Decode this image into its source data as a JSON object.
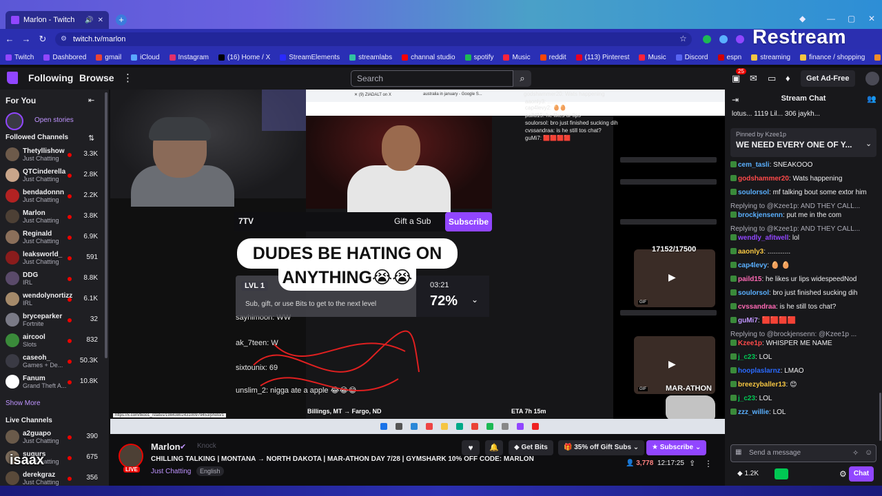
{
  "browser": {
    "tab_title": "Marlon - Twitch",
    "new_tab": "+",
    "url": "twitch.tv/marlon",
    "restream_logo": "Restream",
    "bookmarks": [
      {
        "label": "Twitch",
        "color": "#9146ff"
      },
      {
        "label": "Dashbored",
        "color": "#9146ff"
      },
      {
        "label": "gmail",
        "color": "#ea4335"
      },
      {
        "label": "iCloud",
        "color": "#5aa7ff"
      },
      {
        "label": "Instagram",
        "color": "#e1306c"
      },
      {
        "label": "(16) Home / X",
        "color": "#000000"
      },
      {
        "label": "StreamElements",
        "color": "#2a2aff"
      },
      {
        "label": "streamlabs",
        "color": "#31c3a2"
      },
      {
        "label": "channal studio",
        "color": "#ff0000"
      },
      {
        "label": "spotify",
        "color": "#1db954"
      },
      {
        "label": "Music",
        "color": "#fa233b"
      },
      {
        "label": "reddit",
        "color": "#ff4500"
      },
      {
        "label": "(113) Pinterest",
        "color": "#e60023"
      },
      {
        "label": "Music",
        "color": "#fa233b"
      },
      {
        "label": "Discord",
        "color": "#5865f2"
      },
      {
        "label": "espn",
        "color": "#d00000"
      },
      {
        "label": "streaming",
        "color": "#f5c542"
      },
      {
        "label": "finance / shopping",
        "color": "#f5c542"
      },
      {
        "label": "Cjdropshipping",
        "color": "#f28c28"
      }
    ]
  },
  "topnav": {
    "following": "Following",
    "browse": "Browse",
    "search_placeholder": "Search",
    "notif_count": "25",
    "ad_free": "Get Ad-Free"
  },
  "sidebar": {
    "for_you": "For You",
    "open_stories": "Open stories",
    "followed_channels": "Followed Channels",
    "show_more": "Show More",
    "live_channels": "Live Channels",
    "channels": [
      {
        "name": "Thetyllishow",
        "game": "Just Chatting",
        "viewers": "3.3K",
        "color": "#6d5a4a"
      },
      {
        "name": "QTCinderella",
        "game": "Just Chatting",
        "viewers": "2.8K",
        "color": "#c9a58a"
      },
      {
        "name": "bendadonnn",
        "game": "Just Chatting",
        "viewers": "2.2K",
        "color": "#b22222"
      },
      {
        "name": "Marlon",
        "game": "Just Chatting",
        "viewers": "3.8K",
        "color": "#4d4035"
      },
      {
        "name": "Reginald",
        "game": "Just Chatting",
        "viewers": "6.9K",
        "color": "#8b6f5a"
      },
      {
        "name": "leaksworld_",
        "game": "Just Chatting",
        "viewers": "591",
        "color": "#8a1c1c"
      },
      {
        "name": "DDG",
        "game": "IRL",
        "viewers": "8.8K",
        "color": "#5a4a6a"
      },
      {
        "name": "wendolynortizz",
        "game": "IRL",
        "viewers": "6.1K",
        "color": "#a58a6a"
      },
      {
        "name": "bryceparker",
        "game": "Fortnite",
        "viewers": "32",
        "color": "#7a7a86"
      },
      {
        "name": "aircool",
        "game": "Slots",
        "viewers": "832",
        "color": "#3a8a3a"
      },
      {
        "name": "caseoh_",
        "game": "Games + De...",
        "viewers": "50.3K",
        "color": "#3a3a44"
      },
      {
        "name": "Fanum",
        "game": "Grand Theft A...",
        "viewers": "10.8K",
        "color": "#ffffff"
      }
    ],
    "live": [
      {
        "name": "a2guapo",
        "game": "Just Chatting",
        "viewers": "390",
        "color": "#6a5a4a"
      },
      {
        "name": "sugurs",
        "game": "Just Chatting",
        "viewers": "675",
        "color": "#7a6a5a"
      },
      {
        "name": "derekgraz",
        "game": "Just Chatting",
        "viewers": "356",
        "color": "#5a4a3a"
      }
    ]
  },
  "overlay": {
    "name": "isaax",
    "seven_tv": "7TV",
    "gift_sub": "Gift a Sub",
    "subscribe": "Subscribe",
    "caption_line1": "DUDES BE HATING ON",
    "caption_line2": "ANYTHING😭😭",
    "level": "LVL 1",
    "level_hint": "Sub, gift, or use Bits to get to the next level",
    "level_time": "03:21",
    "level_pct": "72%",
    "goal": "17152/17500",
    "marathon": "MAR-ATHON",
    "route": "Billings, MT → Fargo, ND",
    "eta": "ETA 7h 15m",
    "chat_lines": [
      "godshammer20: Wats happening",
      "aaonly3: ............",
      "cap4levy2: 🥚🥚",
      "paild15: he likes ur lips",
      "soulorsol: bro just finished sucking dih",
      "cvssandraa: is he still tos chat?",
      "guMi7: 🟥🟥🟥🟥",
      "sayhimoon: WW",
      "ak_7teen: W",
      "sixtounix: 69",
      "unslim_2: nigga ate a apple 😂😂😂"
    ]
  },
  "stream_info": {
    "channel": "Marlon",
    "knock": "Knock",
    "live": "LIVE",
    "title": "CHILLING TALKING | MONTANA → NORTH DAKOTA | MAR-ATHON DAY 7/28 | GYMSHARK 10% OFF CODE: MARLON",
    "category": "Just Chatting",
    "tag": "English",
    "get_bits": "Get Bits",
    "gift_subs": "35% off Gift Subs",
    "subscribe": "Subscribe",
    "viewers": "3,778",
    "uptime": "12:17:25"
  },
  "chat": {
    "header": "Stream Chat",
    "gifters": "lotus... 1119  Lil... 306  jaykh...",
    "pinned_by": "Pinned by Kzee1p",
    "pinned_msg": "WE NEED EVERY ONE OF Y...",
    "input_placeholder": "Send a message",
    "points": "1.2K",
    "chat_button": "Chat",
    "messages": [
      {
        "user": "cem_tasli",
        "color": "#5ab0ff",
        "text": "SNEAKOOO",
        "reply": ""
      },
      {
        "user": "godshammer20",
        "color": "#ff4a4a",
        "text": "Wats happening",
        "reply": ""
      },
      {
        "user": "soulorsol",
        "color": "#5ab0ff",
        "text": "mf talking bout some extor him",
        "reply": ""
      },
      {
        "user": "brockjensenn",
        "color": "#5ab0ff",
        "text": "put me in the com",
        "reply": "Replying to @Kzee1p: AND THEY CALL..."
      },
      {
        "user": "wendly_afitwell",
        "color": "#9146ff",
        "text": "lol",
        "reply": "Replying to @Kzee1p: AND THEY CALL..."
      },
      {
        "user": "aaonly3",
        "color": "#f5c542",
        "text": "............",
        "reply": ""
      },
      {
        "user": "cap4levy",
        "color": "#5ab0ff",
        "text": "🥚 🥚",
        "reply": ""
      },
      {
        "user": "paild15",
        "color": "#ff69b4",
        "text": "he likes ur lips widespeedNod",
        "reply": ""
      },
      {
        "user": "soulorsol",
        "color": "#5ab0ff",
        "text": "bro just finished sucking dih",
        "reply": ""
      },
      {
        "user": "cvssandraa",
        "color": "#ff69b4",
        "text": "is he still tos chat?",
        "reply": ""
      },
      {
        "user": "guMi7",
        "color": "#bf94ff",
        "text": "🟥🟥🟥🟥",
        "reply": ""
      },
      {
        "user": "Kzee1p",
        "color": "#ff4a4a",
        "text": "WHISPER ME NAME",
        "reply": "Replying to @brockjensenn: @Kzee1p ..."
      },
      {
        "user": "j_c23",
        "color": "#00c853",
        "text": "LOL",
        "reply": ""
      },
      {
        "user": "hooplaslarnz",
        "color": "#2a6aff",
        "text": "LMAO",
        "reply": ""
      },
      {
        "user": "breezyballer13",
        "color": "#f5c542",
        "text": "😊",
        "reply": ""
      },
      {
        "user": "j_c23",
        "color": "#00c853",
        "text": "LOL",
        "reply": ""
      },
      {
        "user": "zzz_willie",
        "color": "#5ab0ff",
        "text": "LOL",
        "reply": ""
      }
    ]
  },
  "colors": {
    "twitch_purple": "#9146ff",
    "live_red": "#eb0400",
    "bg_dark": "#0e0e10",
    "panel": "#1f1f23"
  }
}
